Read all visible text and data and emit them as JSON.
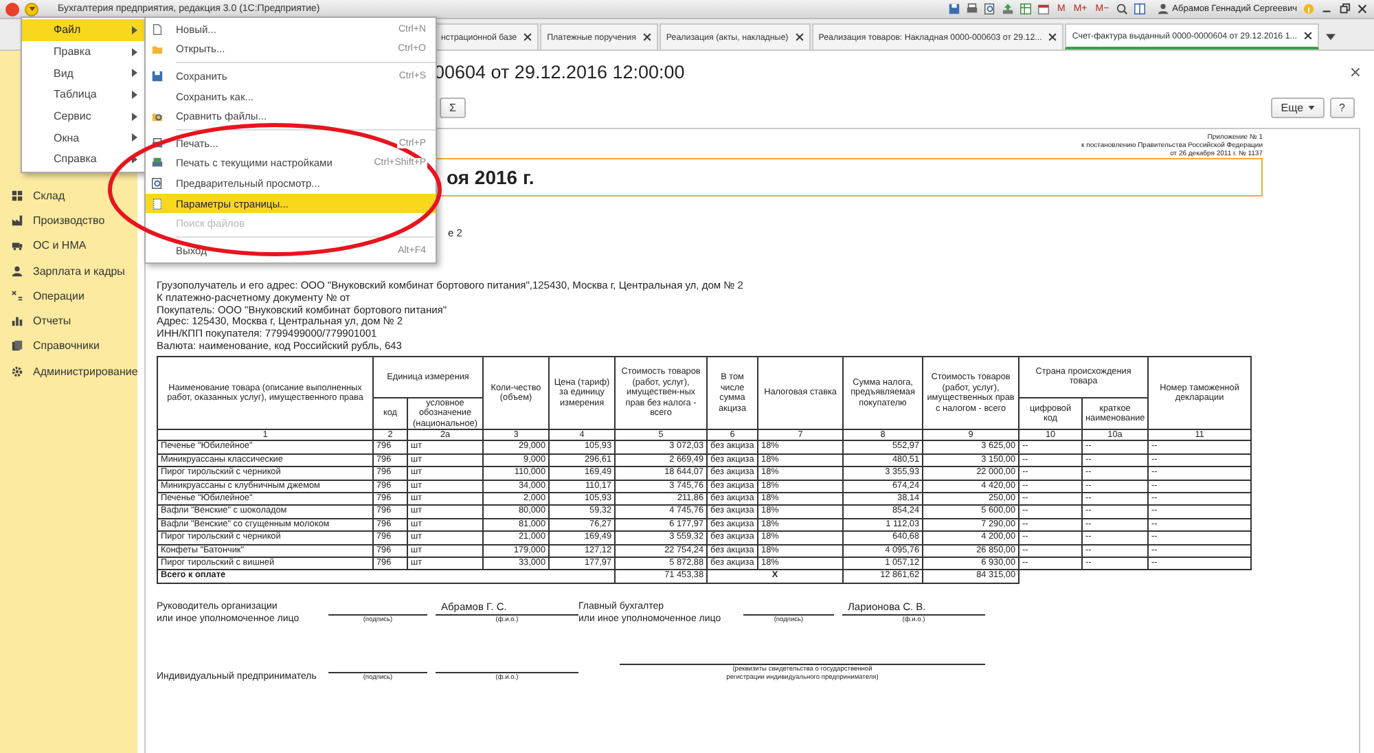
{
  "window": {
    "title": "Бухгалтерия предприятия, редакция 3.0  (1С:Предприятие)",
    "memory_buttons": [
      "M",
      "M+",
      "M−"
    ],
    "user": "Абрамов Геннадий Сергеевич"
  },
  "tabs": [
    {
      "label": "нстрационной базе",
      "selected": false
    },
    {
      "label": "Платежные поручения",
      "selected": false
    },
    {
      "label": "Реализация (акты, накладные)",
      "selected": false
    },
    {
      "label": "Реализация товаров: Накладная 0000-000603 от 29.12...",
      "selected": false
    },
    {
      "label": "Счет-фактура выданный 0000-0000604 от 29.12.2016 1...",
      "selected": true
    }
  ],
  "sidebar": {
    "items": [
      {
        "label": "Склад"
      },
      {
        "label": "Производство"
      },
      {
        "label": "ОС и НМА"
      },
      {
        "label": "Зарплата и кадры"
      },
      {
        "label": "Операции"
      },
      {
        "label": "Отчеты"
      },
      {
        "label": "Справочники"
      },
      {
        "label": "Администрирование"
      }
    ]
  },
  "form": {
    "title": "00604 от 29.12.2016 12:00:00",
    "sum_button": "Σ",
    "more_button": "Еще",
    "help_button": "?"
  },
  "document": {
    "appendix": [
      "Приложение № 1",
      "к постановлению Правительства Российской Федерации",
      "от 26 декабря 2011 г. № 1137"
    ],
    "heading": "оя 2016 г.",
    "fragment": "е 2",
    "lines": [
      "Грузополучатель и его адрес: ООО \"Внуковский комбинат бортового питания\",125430, Москва г, Центральная ул, дом № 2",
      "К платежно-расчетному документу №     от",
      "Покупатель: ООО \"Внуковский комбинат бортового питания\"",
      "Адрес: 125430, Москва г, Центральная ул, дом № 2",
      "ИНН/КПП покупателя: 7799499000/779901001",
      "Валюта: наименование, код Российский рубль, 643"
    ],
    "table": {
      "columns": [
        {
          "label": "Наименование товара (описание выполненных работ, оказанных услуг), имущественного права"
        },
        {
          "label": "Единица измерения",
          "colspan": 2,
          "children": [
            {
              "label": "код"
            },
            {
              "label": "условное обозначение (национальное)"
            }
          ]
        },
        {
          "label": "Коли-чество (объем)"
        },
        {
          "label": "Цена (тариф) за единицу измерения"
        },
        {
          "label": "Стоимость товаров (работ, услуг), имуществен-ных прав без налога - всего"
        },
        {
          "label": "В том числе сумма акциза"
        },
        {
          "label": "Налоговая ставка"
        },
        {
          "label": "Сумма налога, предъявляемая покупателю"
        },
        {
          "label": "Стоимость товаров (работ, услуг), имущественных прав с налогом - всего"
        },
        {
          "label": "Страна происхождения товара",
          "colspan": 2,
          "children": [
            {
              "label": "цифровой код"
            },
            {
              "label": "краткое наименование"
            }
          ]
        },
        {
          "label": "Номер таможенной декларации"
        }
      ],
      "column_numbers": [
        "1",
        "2",
        "2а",
        "3",
        "4",
        "5",
        "6",
        "7",
        "8",
        "9",
        "10",
        "10а",
        "11"
      ],
      "rows": [
        [
          "Печенье \"Юбилейное\"",
          "796",
          "шт",
          "29,000",
          "105,93",
          "3 072,03",
          "без акциза",
          "18%",
          "552,97",
          "3 625,00",
          "--",
          "--",
          "--"
        ],
        [
          "Миникруассаны классические",
          "796",
          "шт",
          "9,000",
          "296,61",
          "2 669,49",
          "без акциза",
          "18%",
          "480,51",
          "3 150,00",
          "--",
          "--",
          "--"
        ],
        [
          "Пирог тирольский с черникой",
          "796",
          "шт",
          "110,000",
          "169,49",
          "18 644,07",
          "без акциза",
          "18%",
          "3 355,93",
          "22 000,00",
          "--",
          "--",
          "--"
        ],
        [
          "Миникруассаны с клубничным джемом",
          "796",
          "шт",
          "34,000",
          "110,17",
          "3 745,76",
          "без акциза",
          "18%",
          "674,24",
          "4 420,00",
          "--",
          "--",
          "--"
        ],
        [
          "Печенье \"Юбилейное\"",
          "796",
          "шт",
          "2,000",
          "105,93",
          "211,86",
          "без акциза",
          "18%",
          "38,14",
          "250,00",
          "--",
          "--",
          "--"
        ],
        [
          "Вафли \"Венские\" с шоколадом",
          "796",
          "шт",
          "80,000",
          "59,32",
          "4 745,76",
          "без акциза",
          "18%",
          "854,24",
          "5 600,00",
          "--",
          "--",
          "--"
        ],
        [
          "Вафли \"Венские\" со сгущенным молоком",
          "796",
          "шт",
          "81,000",
          "76,27",
          "6 177,97",
          "без акциза",
          "18%",
          "1 112,03",
          "7 290,00",
          "--",
          "--",
          "--"
        ],
        [
          "Пирог тирольский с черникой",
          "796",
          "шт",
          "21,000",
          "169,49",
          "3 559,32",
          "без акциза",
          "18%",
          "640,68",
          "4 200,00",
          "--",
          "--",
          "--"
        ],
        [
          "Конфеты \"Батончик\"",
          "796",
          "шт",
          "179,000",
          "127,12",
          "22 754,24",
          "без акциза",
          "18%",
          "4 095,76",
          "26 850,00",
          "--",
          "--",
          "--"
        ],
        [
          "Пирог тирольский с вишней",
          "796",
          "шт",
          "33,000",
          "177,97",
          "5 872,88",
          "без акциза",
          "18%",
          "1 057,12",
          "6 930,00",
          "--",
          "--",
          "--"
        ]
      ],
      "total": {
        "label": "Всего к оплате",
        "cost": "71 453,38",
        "excise_and_rate": "X",
        "tax": "12 861,62",
        "total": "84 315,00"
      }
    },
    "signatures": {
      "head_label": "Руководитель организации\nили иное уполномоченное лицо",
      "head_name": "Абрамов Г. С.",
      "accountant_label": "Главный бухгалтер\nили иное уполномоченное лицо",
      "accountant_name": "Ларионова С. В.",
      "entrepreneur_label": "Индивидуальный предприниматель",
      "sign_caption": [
        "(подпись)",
        "(подпись)",
        "(подпись)"
      ],
      "name_caption": [
        "(ф.и.о.)",
        "(ф.и.о.)",
        "(ф.и.о.)"
      ],
      "requisites_caption": "(реквизиты свидетельства о государственной\nрегистрации индивидуального предпринимателя)"
    }
  },
  "main_menu": {
    "items": [
      {
        "label": "Файл",
        "selected": true
      },
      {
        "label": "Правка",
        "selected": false
      },
      {
        "label": "Вид",
        "selected": false
      },
      {
        "label": "Таблица",
        "selected": false
      },
      {
        "label": "Сервис",
        "selected": false
      },
      {
        "label": "Окна",
        "selected": false
      },
      {
        "label": "Справка",
        "selected": false
      }
    ]
  },
  "file_menu": {
    "items": [
      {
        "kind": "item",
        "label": "Новый...",
        "shortcut": "Ctrl+N",
        "selected": false,
        "disabled": false
      },
      {
        "kind": "item",
        "label": "Открыть...",
        "shortcut": "Ctrl+O",
        "selected": false,
        "disabled": false
      },
      {
        "kind": "separator"
      },
      {
        "kind": "item",
        "label": "Сохранить",
        "shortcut": "Ctrl+S",
        "selected": false,
        "disabled": false
      },
      {
        "kind": "item",
        "label": "Сохранить как...",
        "selected": false,
        "disabled": false
      },
      {
        "kind": "item",
        "label": "Сравнить файлы...",
        "selected": false,
        "disabled": false
      },
      {
        "kind": "separator"
      },
      {
        "kind": "item",
        "label": "Печать...",
        "shortcut": "Ctrl+P",
        "selected": false,
        "disabled": false
      },
      {
        "kind": "item",
        "label": "Печать с текущими настройками",
        "shortcut": "Ctrl+Shift+P",
        "selected": false,
        "disabled": false
      },
      {
        "kind": "item",
        "label": "Предварительный просмотр...",
        "selected": false,
        "disabled": false
      },
      {
        "kind": "item",
        "label": "Параметры страницы...",
        "selected": true,
        "disabled": false
      },
      {
        "kind": "item",
        "label": "Поиск файлов",
        "selected": false,
        "disabled": true
      },
      {
        "kind": "separator"
      },
      {
        "kind": "item",
        "label": "Выход",
        "shortcut": "Alt+F4",
        "selected": false,
        "disabled": false
      }
    ]
  }
}
